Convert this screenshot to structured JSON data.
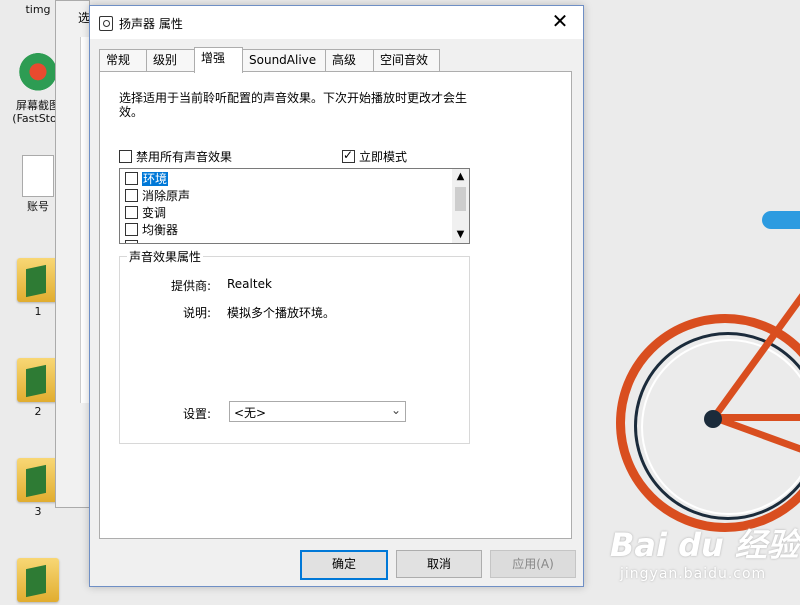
{
  "desktop": {
    "icons": [
      {
        "label": "timg"
      },
      {
        "label": "屏幕截图 (FastSton"
      },
      {
        "label": "账号"
      },
      {
        "label": "1"
      },
      {
        "label": "2"
      },
      {
        "label": "3"
      },
      {
        "label": ""
      }
    ],
    "background_window": {
      "title": "选"
    },
    "watermark": {
      "brand": "Bai du 经验",
      "url": "jingyan.baidu.com"
    }
  },
  "dialog": {
    "title": "扬声器 属性",
    "close_symbol": "✕",
    "tabs": [
      {
        "label": "常规"
      },
      {
        "label": "级别"
      },
      {
        "label": "增强",
        "active": true
      },
      {
        "label": "SoundAlive"
      },
      {
        "label": "高级"
      },
      {
        "label": "空间音效"
      }
    ],
    "description": "选择适用于当前聆听配置的声音效果。下次开始播放时更改才会生效。",
    "disable_all": {
      "label": "禁用所有声音效果",
      "checked": false
    },
    "immediate_mode": {
      "label": "立即模式",
      "checked": true
    },
    "effects": [
      {
        "label": "环境",
        "checked": false,
        "selected": true
      },
      {
        "label": "消除原声",
        "checked": false
      },
      {
        "label": "变调",
        "checked": false
      },
      {
        "label": "均衡器",
        "checked": false
      },
      {
        "label": "",
        "checked": false
      }
    ],
    "properties": {
      "title": "声音效果属性",
      "provider_label": "提供商:",
      "provider": "Realtek",
      "status_label": "说明:",
      "status": "模拟多个播放环境。",
      "setting_label": "设置:",
      "setting_value": "<无>"
    },
    "buttons": {
      "ok": "确定",
      "cancel": "取消",
      "apply": "应用(A)"
    }
  },
  "colors": {
    "accent": "#0078d7",
    "bike_red": "#d94e1f",
    "bike_blue": "#2d9be0"
  }
}
